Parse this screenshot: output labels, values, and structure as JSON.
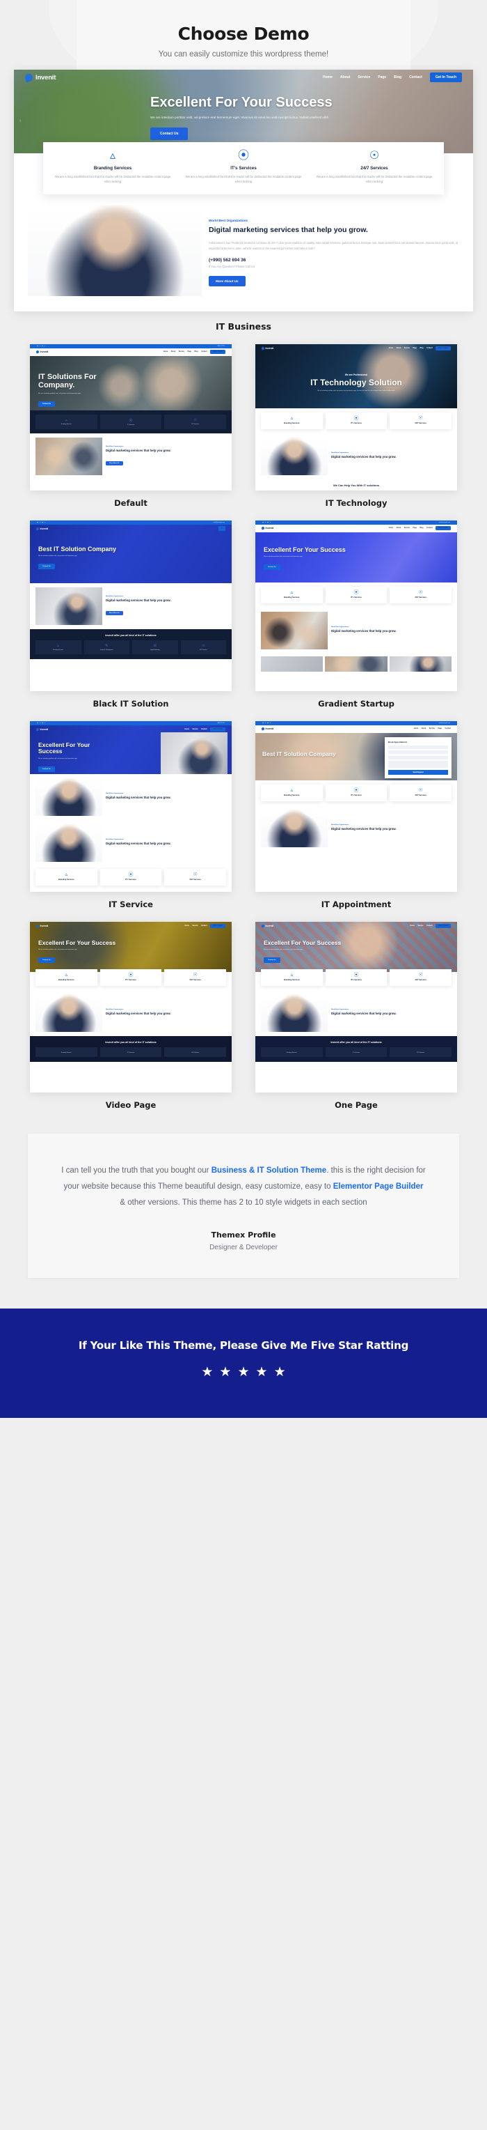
{
  "header": {
    "title": "Choose Demo",
    "subtitle": "You can easily customize this wordpress theme!"
  },
  "brand": {
    "name": "Invenit",
    "accent": "#1565d8",
    "deep_blue": "#141e8c",
    "link_blue": "#1a6bff"
  },
  "site_nav": {
    "items": [
      "Home",
      "About",
      "Service",
      "Page",
      "Blog",
      "Contact"
    ],
    "cta": "Get In Touch",
    "topbar_phone": "+880 01 1111",
    "topbar_email": "info@example.com"
  },
  "featured": {
    "label": "IT Business",
    "hero": {
      "heading": "Excellent For Your Success",
      "paragraph": "We are interdum porttitor velit, vel pretium erat fermentum eget. Vivamus sit amet leo velit suscipit luctus. Nullam eleifend nibh",
      "button": "Contact Us"
    },
    "cards": [
      {
        "icon": "branding-icon",
        "title": "Branding Services",
        "text": "We are a long established fact that the reader will be distracted the readable content page when looking"
      },
      {
        "icon": "it-service-icon",
        "title": "IT's Services",
        "text": "We are a long established fact that the reader will be distracted the readable content page when looking"
      },
      {
        "icon": "support-icon",
        "title": "24/7 Services",
        "text": "We are a long established fact that the reader will be distracted the readable content page when looking"
      }
    ],
    "marketing": {
      "eyebrow": "World Best Organizations",
      "heading": "Digital marketing services that help you grow.",
      "paragraph": "Automotive's four Frederick locations continue its 20++ plus years tradition of quality auto-repair services.  pulvinar lectus tristique non. Nam laoreet risus vel laoreet laoreet, mauris risus porta velit, id imperdiet ante nisi in ante. vehicle owners in the nearest gym enter and take a look?",
      "phone": "(+990) 562 694 36",
      "phone_note": "If You Any Question? Please Call Us.",
      "button": "More About Us"
    }
  },
  "demos": [
    {
      "label": "Default",
      "style": "default",
      "hero_heading": "IT Solutions For Company.",
      "hero_paragraph": "We are interdum porttitor velit, vel pretium erat fermentum eget.",
      "hero_button": "Contact Us",
      "strip_title": "",
      "cards": [
        "Branding Services",
        "IT's Services",
        "24/7 Services"
      ],
      "split_eyebrow": "World Best Organizations",
      "split_heading": "Digital marketing services that help you grow.",
      "split_button": "More About Us"
    },
    {
      "label": "IT Technology",
      "style": "technology",
      "hero_eyebrow": "We are Professional",
      "hero_heading": "IT Technology Solution",
      "hero_paragraph": "We are interdum porttitor velit, vel pretium erat fermentum eget. Vivamus sit amet leo velit suscipit luctus. Nullam eleifend nibh",
      "cards": [
        "Branding Services",
        "IT's Services",
        "24/7 Services"
      ],
      "split_eyebrow": "World Best Organizations",
      "split_heading": "Digital marketing services that help you grow.",
      "strip_title": "We Can Help You With IT solutions"
    },
    {
      "label": "Black IT Solution",
      "style": "black",
      "hero_heading": "Best IT Solution Company",
      "hero_paragraph": "We are interdum porttitor velit, vel pretium erat fermentum eget.",
      "hero_button": "Contact Us",
      "split_eyebrow": "World Best Organizations",
      "split_heading": "Digital marketing services that help you grow.",
      "split_button": "More About Us",
      "strip_title": "Invenit offer you all kind of the IT solutions",
      "strip_items": [
        "Branding Services",
        "Design & Development",
        "Digital Marketing",
        "24/7 Services"
      ]
    },
    {
      "label": "Gradient Startup",
      "style": "gradient",
      "hero_heading": "Excellent For Your Success",
      "hero_paragraph": "We are interdum porttitor velit, vel pretium erat fermentum eget.",
      "hero_button": "Contact Us",
      "cards": [
        "Branding Services",
        "IT's Services",
        "24/7 Services"
      ],
      "split_eyebrow": "World Best Organizations",
      "split_heading": "Digital marketing services that help you grow."
    },
    {
      "label": "IT Service",
      "style": "service",
      "hero_heading": "Excellent For Your Success",
      "hero_paragraph": "We are interdum porttitor velit, vel pretium erat fermentum eget.",
      "hero_button": "Contact Us",
      "split_eyebrow": "World Best Organizations",
      "split_heading": "Digital marketing services that help you grow.",
      "cards": [
        "Branding Services",
        "IT's Services",
        "24/7 Services"
      ]
    },
    {
      "label": "IT Appointment",
      "style": "appointment",
      "hero_heading": "Best IT Solution Company",
      "form_title": "Book Appointment",
      "form_button": "Send Request",
      "cards": [
        "Branding Services",
        "IT's Services",
        "24/7 Services"
      ],
      "split_eyebrow": "World Best Organizations",
      "split_heading": "Digital marketing services that help you grow."
    },
    {
      "label": "Video Page",
      "style": "video",
      "hero_heading": "Excellent For Your Success",
      "hero_paragraph": "We are interdum porttitor velit, vel pretium erat fermentum eget.",
      "hero_button": "Contact Us",
      "cards": [
        "Branding Services",
        "IT's Services",
        "24/7 Services"
      ],
      "split_eyebrow": "World Best Organizations",
      "split_heading": "Digital marketing services that help you grow.",
      "strip_title": "Invenit offer you all kind of the IT solutions"
    },
    {
      "label": "One Page",
      "style": "onepage",
      "hero_heading": "Excellent For Your Success",
      "hero_paragraph": "We are interdum porttitor velit, vel pretium erat fermentum eget.",
      "hero_button": "Contact Us",
      "cards": [
        "Branding Services",
        "IT's Services",
        "24/7 Services"
      ],
      "split_eyebrow": "World Best Organizations",
      "split_heading": "Digital marketing services that help you grow.",
      "strip_title": "Invenit offer you all kind of the IT solutions"
    }
  ],
  "testimonial": {
    "line1_pre": "I can tell you the truth that you bought our ",
    "link1": "Business & IT Solution Theme",
    "line1_post": ".",
    "line2": "this is the right decision for your website because this Theme beautiful",
    "line3_pre": "design, easy customize, easy to ",
    "link2": "Elementor Page Builder",
    "line3_post": " & other versions.",
    "line4": "This theme has 2 to 10 style widgets in each section",
    "name": "Themex Profile",
    "role": "Designer & Developer"
  },
  "footer": {
    "heading": "If Your Like This Theme, Please Give Me Five Star Ratting",
    "star_count": 5,
    "star_glyph": "★"
  }
}
